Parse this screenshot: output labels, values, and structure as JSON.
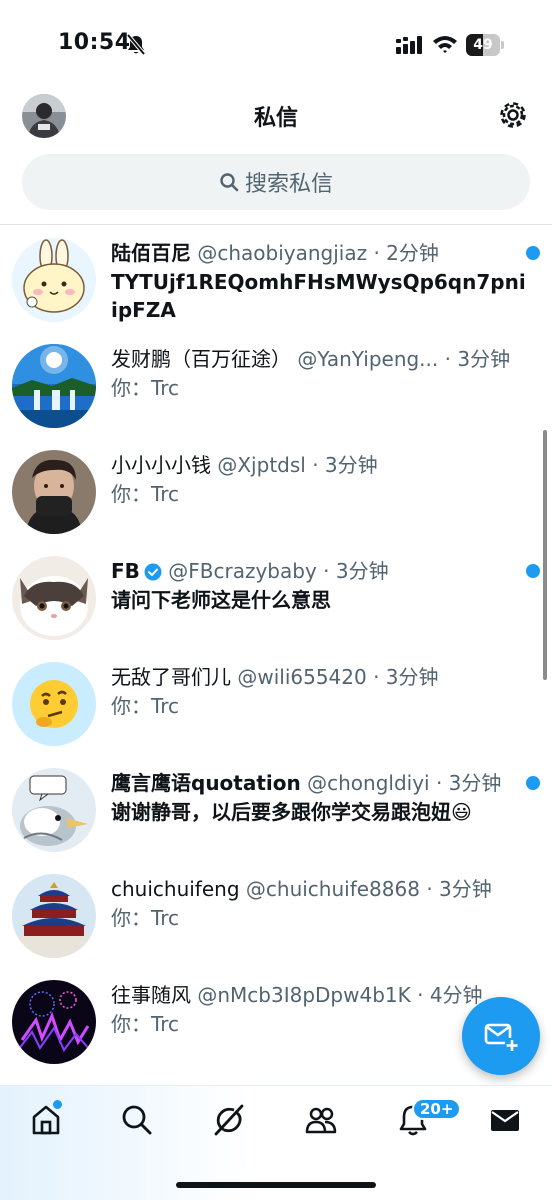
{
  "status_bar": {
    "time": "10:54",
    "battery": "49",
    "battery_level": 0.49
  },
  "header": {
    "title": "私信"
  },
  "search": {
    "placeholder": "搜索私信"
  },
  "conversations": [
    {
      "name": "陆佰百尼",
      "handle": "@chaobiyangjiaz",
      "time": "· 2分钟",
      "preview": "TYTUjf1REQomhFHsMWysQp6qn7pniipFZA",
      "unread": true,
      "verified": false
    },
    {
      "name": "发财鹏（百万征途）",
      "handle": "@YanYipeng...",
      "time": "· 3分钟",
      "preview": "你：Trc",
      "unread": false,
      "verified": false
    },
    {
      "name": "小小小小钱",
      "handle": "@Xjptdsl",
      "time": "· 3分钟",
      "preview": "你：Trc",
      "unread": false,
      "verified": false
    },
    {
      "name": "FB",
      "handle": "@FBcrazybaby",
      "time": "· 3分钟",
      "preview": "请问下老师这是什么意思",
      "unread": true,
      "verified": true
    },
    {
      "name": "无敌了哥们儿",
      "handle": "@wili655420",
      "time": "· 3分钟",
      "preview": "你：Trc",
      "unread": false,
      "verified": false
    },
    {
      "name": "鹰言鹰语quotation",
      "handle": "@chongldiyi",
      "time": "· 3分钟",
      "preview": "谢谢静哥，以后要多跟你学交易跟泡妞😃",
      "unread": true,
      "verified": false
    },
    {
      "name": "chuichuifeng",
      "handle": "@chuichuife8868",
      "time": "· 3分钟",
      "preview": "你：Trc",
      "unread": false,
      "verified": false
    },
    {
      "name": "往事随风",
      "handle": "@nMcb3I8pDpw4b1K",
      "time": "· 4分钟",
      "preview": "你：Trc",
      "unread": false,
      "verified": false
    }
  ],
  "bottom_nav": {
    "items": [
      "home-icon",
      "search-icon",
      "grok-icon",
      "communities-icon",
      "notifications-icon",
      "messages-icon"
    ],
    "notifications_badge": "20+"
  },
  "colors": {
    "accent": "#1d9bf0",
    "text_primary": "#0f1419",
    "text_secondary": "#536471"
  }
}
